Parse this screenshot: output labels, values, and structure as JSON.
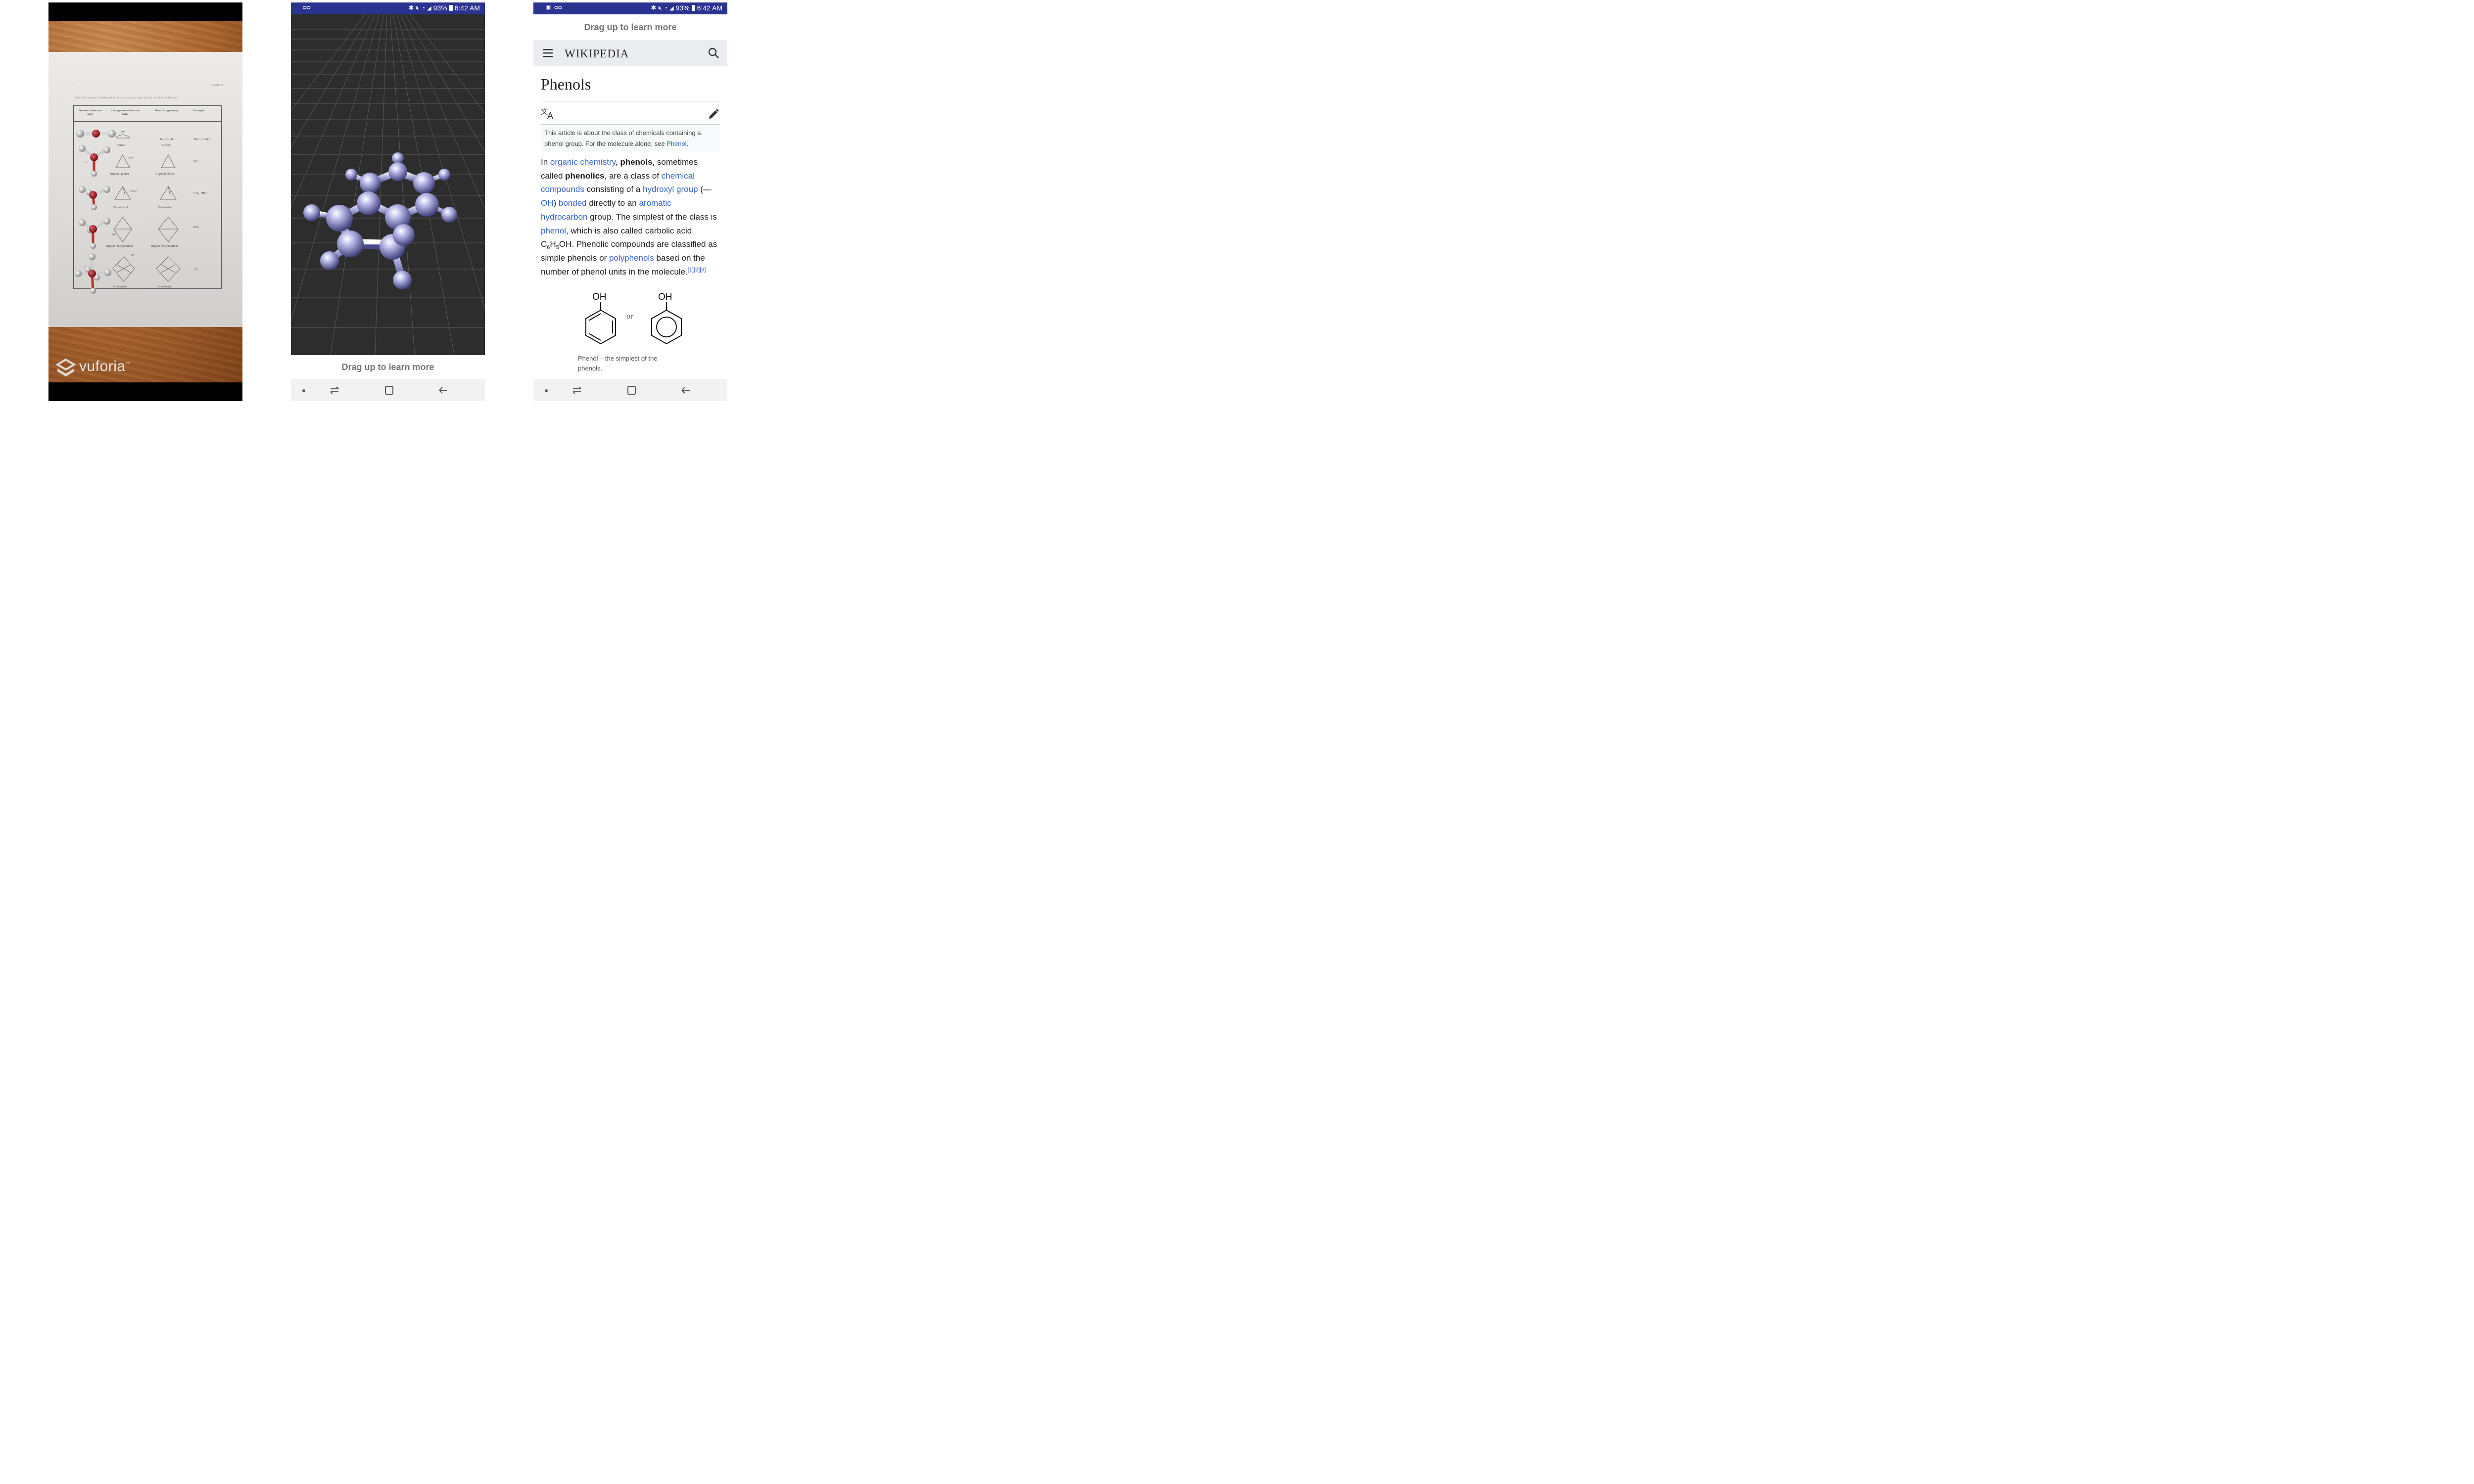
{
  "ar_panel": {
    "page_number": "116",
    "page_header": "CHEMISTRY",
    "table_caption": "Table 4.6 Geometry of Molecules in which the Central Atom has No Lone Pair of Electrons",
    "headers": [
      "Number of electron pairs",
      "Arrangement of electron pairs",
      "Molecular geometry",
      "Examples"
    ],
    "rows": [
      {
        "count": "2",
        "angle": "180°",
        "arrangement": "Linear",
        "formula": "B—A—B",
        "geometry": "Linear",
        "examples": "BeCl₂, HgCl₂"
      },
      {
        "count": "3",
        "angle": "120°",
        "arrangement": "Trigonal planar",
        "formula": "",
        "geometry": "Trigonal planar",
        "examples": "BF₃"
      },
      {
        "count": "4",
        "angle": "109.5°",
        "arrangement": "Tetrahedral",
        "formula": "",
        "geometry": "Tetrahedral",
        "examples": "CH₄, NH₄⁺"
      },
      {
        "count": "5",
        "angle": "120°",
        "arrangement": "Trigonal bipyramidal",
        "formula": "",
        "geometry": "Trigonal bipyramidal",
        "examples": "PCl₅"
      },
      {
        "count": "6",
        "angle": "90°",
        "arrangement": "Octahedral",
        "formula": "",
        "geometry": "Octahedral",
        "examples": "SF₆"
      }
    ],
    "brand": "vuforia",
    "trademark": "™"
  },
  "status_bar": {
    "battery": "93%",
    "time": "6:42 AM"
  },
  "viewer_panel": {
    "drag_hint": "Drag up to learn more"
  },
  "wiki_panel": {
    "drag_hint": "Drag up to learn more",
    "wordmark": "WIKIPEDIA",
    "title": "Phenols",
    "hatnote": {
      "text": "This article is about the class of chemicals containing a phenol group. For the molecule alone, see ",
      "link": "Phenol",
      "end": "."
    },
    "body": {
      "t1": "In ",
      "l1": "organic chemistry",
      "t2": ", ",
      "b1": "phenols",
      "t3": ", sometimes called ",
      "b2": "phenolics",
      "t4": ", are a class of ",
      "l2": "chemical compounds",
      "t5": " consisting of a ",
      "l3": "hydroxyl group",
      "t6": " (—",
      "l4": "OH",
      "t7": ") ",
      "l5": "bonded",
      "t8": " directly to an ",
      "l6": "aromatic hydrocarbon",
      "t9": " group. The simplest of the class is ",
      "l7": "phenol",
      "t10": ", which is also called carbolic acid C",
      "s1": "6",
      "t11": "H",
      "s2": "5",
      "t12": "OH. Phenolic compounds are classified as simple phenols or ",
      "l8": "polyphenols",
      "t13": " based on the number of phenol units in the molecule.",
      "refs": "[1][2][3]"
    },
    "figure": {
      "label_left": "OH",
      "label_right": "OH",
      "or_text": "or",
      "caption": "Phenol – the simplest of the phenols."
    }
  },
  "colors": {
    "status_bar": "#2b3391",
    "link": "#3366cc",
    "atom": "#9a9ad0",
    "oxygen": "#b8202a"
  }
}
